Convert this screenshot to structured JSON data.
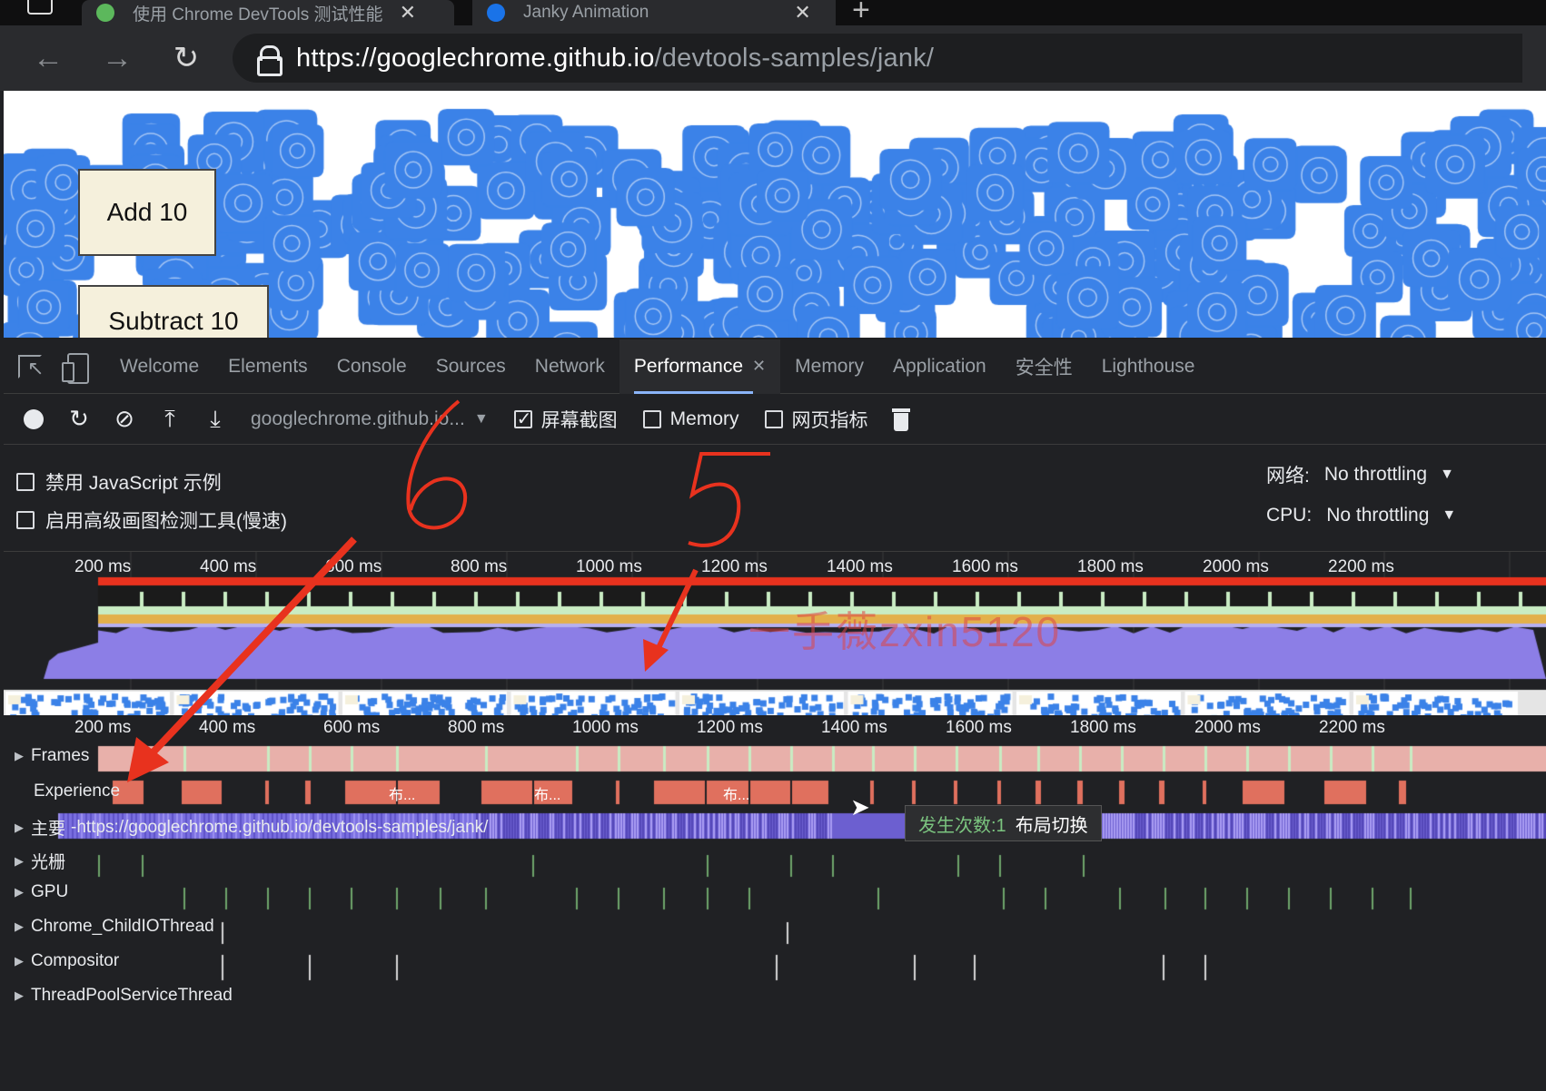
{
  "browser": {
    "tabs": [
      {
        "title": "使用 Chrome DevTools 测试性能"
      },
      {
        "title": "Janky Animation"
      }
    ],
    "url": {
      "host": "https://googlechrome.github.io",
      "path": "/devtools-samples/jank/"
    }
  },
  "page": {
    "add_label": "Add 10",
    "subtract_label": "Subtract 10"
  },
  "devtools": {
    "tabs": [
      "Welcome",
      "Elements",
      "Console",
      "Sources",
      "Network",
      "Performance",
      "Memory",
      "Application",
      "安全性",
      "Lighthouse"
    ],
    "active_tab": "Performance",
    "toolbar": {
      "profile": "googlechrome.github.io...",
      "screenshots_label": "屏幕截图",
      "screenshots_checked": true,
      "memory_label": "Memory",
      "memory_checked": false,
      "web_vitals_label": "网页指标",
      "web_vitals_checked": false
    },
    "settings": {
      "disable_js_samples": "禁用 JavaScript 示例",
      "advanced_paint": "启用高级画图检测工具(慢速)",
      "network_label": "网络:",
      "network_value": "No throttling",
      "cpu_label": "CPU:",
      "cpu_value": "No throttling"
    },
    "overview_ticks": [
      "200 ms",
      "400 ms",
      "600 ms",
      "800 ms",
      "1000 ms",
      "1200 ms",
      "1400 ms",
      "1600 ms",
      "1800 ms",
      "2000 ms",
      "2200 ms"
    ],
    "timeline_ticks": [
      "200 ms",
      "400 ms",
      "600 ms",
      "800 ms",
      "1000 ms",
      "1200 ms",
      "1400 ms",
      "1600 ms",
      "1800 ms",
      "2000 ms",
      "2200 ms"
    ],
    "tracks": {
      "frames": "Frames",
      "experience": "Experience",
      "main": "主要",
      "main_url": "-https://googlechrome.github.io/devtools-samples/jank/",
      "raster": "光栅",
      "gpu": "GPU",
      "child_io": "Chrome_ChildIOThread",
      "compositor": "Compositor",
      "thread_pool": "ThreadPoolServiceThread"
    },
    "experience_labels": [
      "布...",
      "布...",
      "布..."
    ],
    "tooltip": {
      "count": "发生次数:1",
      "name": "布局切换"
    },
    "watermark": "一手薇zxin5120"
  },
  "annotations": {
    "left_number": "6",
    "right_number": "5"
  },
  "colors": {
    "chrome_blue": "#3b82e8",
    "frames_pink": "#e8b0aa",
    "experience_red": "#e0705e",
    "fps_green": "#c9ecc3",
    "scripting_yellow": "#e3b04b",
    "rendering_purple": "#8c7ee6",
    "annotation_red": "#e8321e"
  }
}
